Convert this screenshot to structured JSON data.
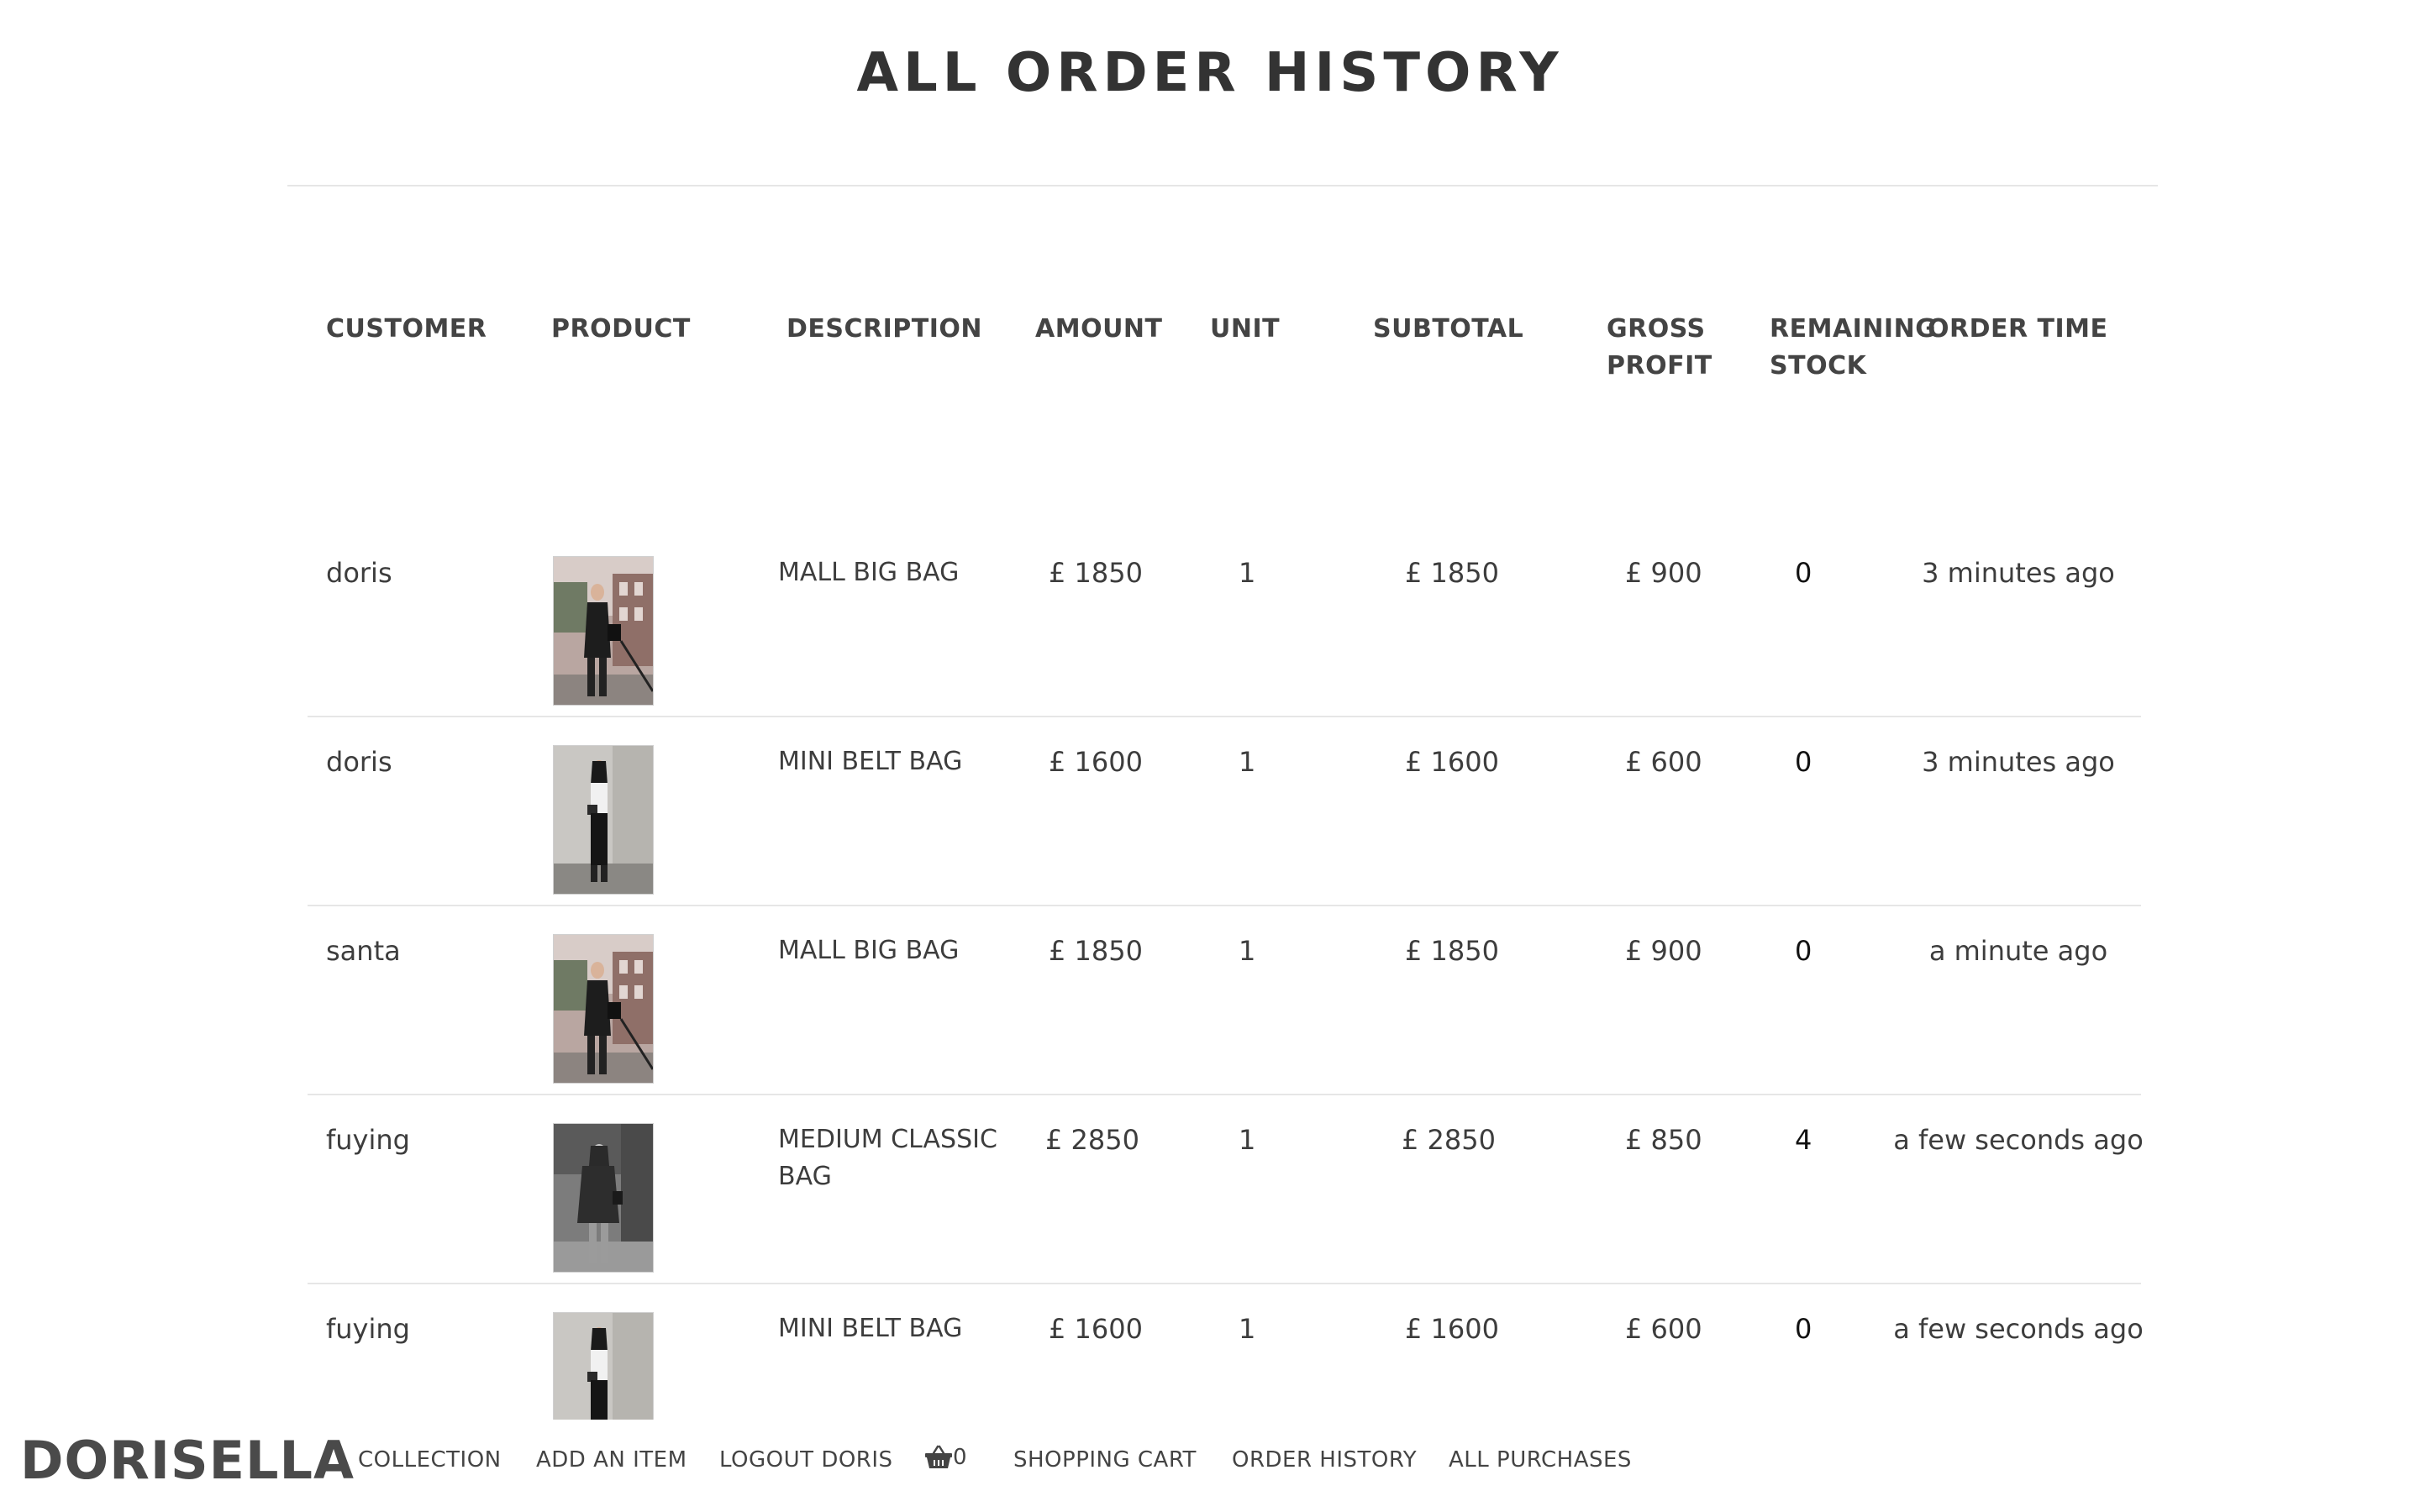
{
  "page": {
    "title": "ALL ORDER HISTORY"
  },
  "table": {
    "columns": {
      "customer": "CUSTOMER",
      "product": "PRODUCT",
      "description": "DESCRIPTION",
      "amount": "AMOUNT",
      "unit": "UNIT",
      "subtotal": "SUBTOTAL",
      "gross_profit_1": "GROSS",
      "gross_profit_2": "PROFIT",
      "remaining_stock_1": "REMAINING",
      "remaining_stock_2": "STOCK",
      "order_time": "ORDER TIME"
    },
    "rows": [
      {
        "customer": "doris",
        "product_image": "woman-street-black-coat-photo",
        "description": "MALL BIG BAG",
        "amount": "£ 1850",
        "unit": "1",
        "subtotal": "£ 1850",
        "gross_profit": "£ 900",
        "remaining_stock": "0",
        "order_time": "3 minutes ago"
      },
      {
        "customer": "doris",
        "product_image": "woman-wall-white-top-photo",
        "description": "MINI BELT BAG",
        "amount": "£ 1600",
        "unit": "1",
        "subtotal": "£ 1600",
        "gross_profit": "£ 600",
        "remaining_stock": "0",
        "order_time": "3 minutes ago"
      },
      {
        "customer": "santa",
        "product_image": "woman-street-black-coat-photo",
        "description": "MALL BIG BAG",
        "amount": "£ 1850",
        "unit": "1",
        "subtotal": "£ 1850",
        "gross_profit": "£ 900",
        "remaining_stock": "0",
        "order_time": "a minute ago"
      },
      {
        "customer": "fuying",
        "product_image": "woman-bw-long-coat-photo",
        "description": "MEDIUM CLASSIC BAG",
        "amount": "£ 2850",
        "unit": "1",
        "subtotal": "£ 2850",
        "gross_profit": "£ 850",
        "remaining_stock": "4",
        "order_time": "a few seconds ago"
      },
      {
        "customer": "fuying",
        "product_image": "woman-wall-white-top-photo",
        "description": "MINI BELT BAG",
        "amount": "£ 1600",
        "unit": "1",
        "subtotal": "£ 1600",
        "gross_profit": "£ 600",
        "remaining_stock": "0",
        "order_time": "a few seconds ago"
      }
    ]
  },
  "nav": {
    "brand": "DORISELLA",
    "collection": "COLLECTION",
    "add_item": "ADD AN ITEM",
    "logout": "LOGOUT DORIS",
    "cart_icon": "basket-icon",
    "cart_count": "0",
    "shopping_cart": "SHOPPING CART",
    "order_history": "ORDER HISTORY",
    "all_purchases": "ALL PURCHASES"
  }
}
